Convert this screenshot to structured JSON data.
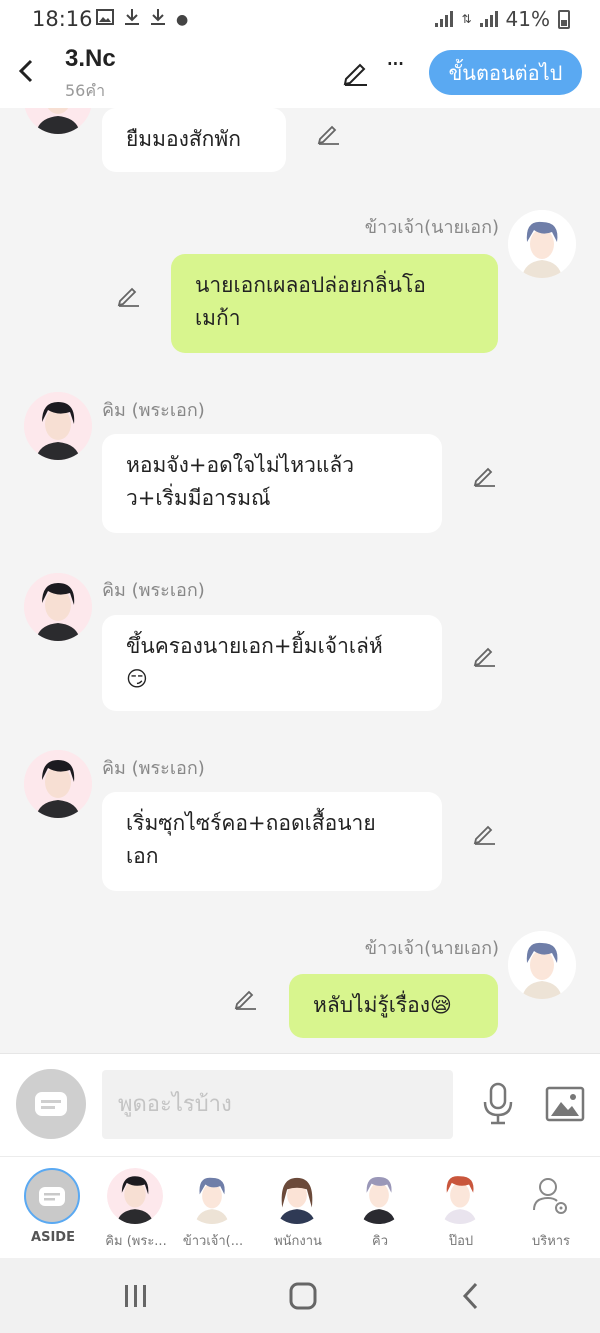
{
  "status_bar": {
    "time": "18:16",
    "battery": "41%"
  },
  "header": {
    "title": "3.Nc",
    "word_count": "56คำ",
    "next_button": "ขั้นตอนต่อไป"
  },
  "messages": [
    {
      "sender": "",
      "text": "ยืมมองสักพัก",
      "side": "left"
    },
    {
      "sender": "ข้าวเจ้า(นายเอก)",
      "text": "นายเอกเผลอปล่อยกลิ่นโอเมก้า",
      "line1": "นายเอกเผลอปล่อยกลิ่นโอ",
      "line2": "เมก้า",
      "side": "right"
    },
    {
      "sender": "คิม (พระเอก)",
      "text": "หอมจังง+อดใจไม่ไหวแล้วว+เริ่มมีอารมณ์",
      "line1": "หอมจัง+อดใจไม่ไหวแล้ว",
      "line2": "ว+เริ่มมีอารมณ์",
      "side": "left"
    },
    {
      "sender": "คิม (พระเอก)",
      "text": "ขึ้นครองนายเอก+ยิ้มเจ้าเล่ห์😏",
      "line1": "ขึ้นครองนายเอก+ยิ้มเจ้าเล่ห์",
      "line2": "😏",
      "side": "left"
    },
    {
      "sender": "คิม (พระเอก)",
      "text": "เริ่มซุกไซร์คอ+ถอดเสื้อนายเอก",
      "line1": "เริ่มซุกไซร์คอ+ถอดเสื้อนาย",
      "line2": "เอก",
      "side": "left"
    },
    {
      "sender": "ข้าวเจ้า(นายเอก)",
      "text": "หลับไม่รู้เรื่อง😪",
      "side": "right"
    }
  ],
  "input": {
    "placeholder": "พูดอะไรบ้าง"
  },
  "characters": [
    {
      "label": "ASIDE"
    },
    {
      "label": "คิม (พระ..."
    },
    {
      "label": "ข้าวเจ้า(..."
    },
    {
      "label": "พนักงาน"
    },
    {
      "label": "คิว"
    },
    {
      "label": "ป๊อป"
    },
    {
      "label": "บริหาร"
    }
  ],
  "colors": {
    "accent": "#5aa9f2",
    "bubble_green": "#d8f58e",
    "bubble_white": "#ffffff",
    "background": "#f4f4f4"
  }
}
